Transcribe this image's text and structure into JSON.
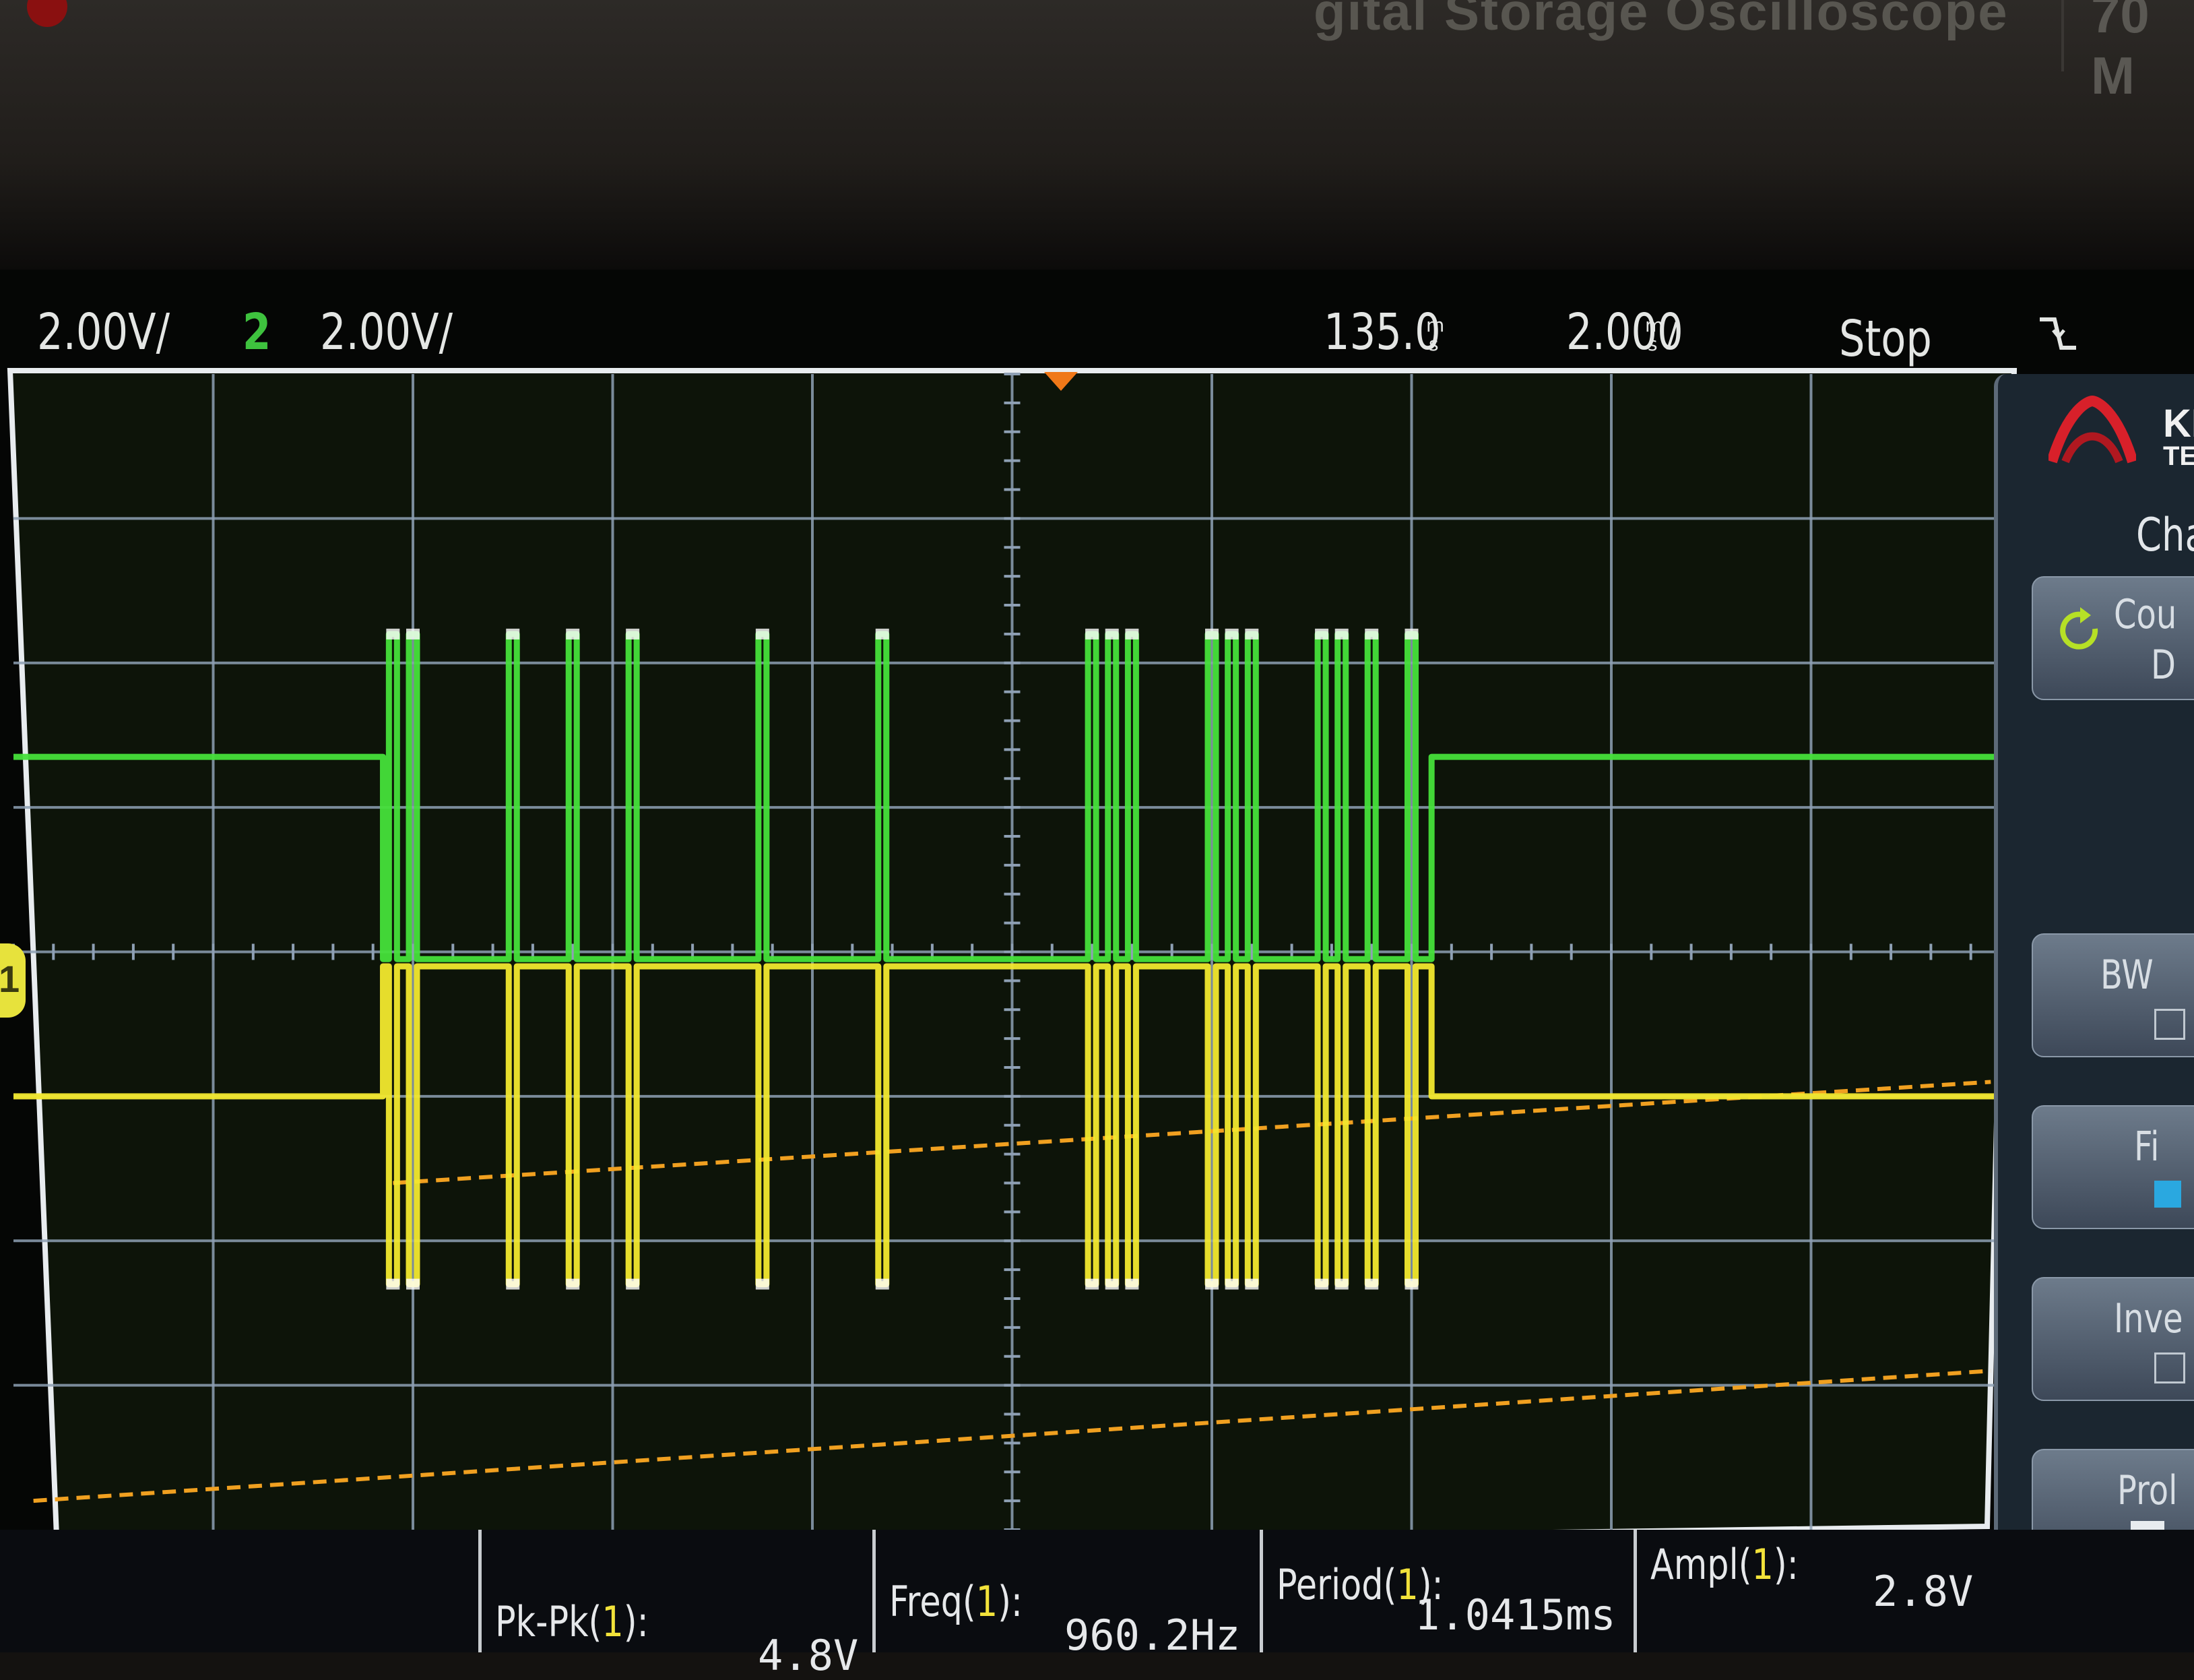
{
  "bezel": {
    "title": "gital Storage Oscilloscope",
    "bandwidth_fragment": "70 M"
  },
  "status_bar": {
    "ch1_scale": "2.00V/",
    "ch2_number": "2",
    "ch2_scale": "2.00V/",
    "horizontal_position": "135.0",
    "horizontal_position_unit_icon": "ms-unit-glyph",
    "timebase": "2.000",
    "timebase_unit_icon": "ms-per-div-glyph",
    "run_state": "Stop",
    "trigger_icon": "falling-edge-trigger-icon"
  },
  "colors": {
    "ch1": "#f2e82e",
    "ch2": "#46e03a",
    "threshold": "#f0a020",
    "grid": "#8ea0b4",
    "trigger_marker": "#f07818"
  },
  "side_menu": {
    "logo_text": "KE",
    "logo_sub": "TE",
    "title": "Cha",
    "items": [
      {
        "label": "Cou",
        "sub": "D",
        "icon": "rotate-knob-icon"
      },
      {
        "label": "BW",
        "sub": ""
      },
      {
        "label": "Fi",
        "sub": ""
      },
      {
        "label": "Inve",
        "sub": ""
      },
      {
        "label": "Prol",
        "sub": "",
        "icon": "arrow-down-icon"
      }
    ]
  },
  "measurements": [
    {
      "name": "Pk-Pk",
      "channel": "1",
      "value": "4.8V"
    },
    {
      "name": "Freq",
      "channel": "1",
      "value": "960.2Hz"
    },
    {
      "name": "Period",
      "channel": "1",
      "value": "1.0415ms"
    },
    {
      "name": "Ampl",
      "channel": "1",
      "value": "2.8V"
    }
  ],
  "channel_marker": {
    "label": "1"
  },
  "chart_data": {
    "type": "line",
    "series": [
      {
        "name": "2",
        "idle_level": "high",
        "pulses_ms": [
          [
            -6.2,
            -6.0
          ],
          [
            -5.0,
            -4.4
          ],
          [
            -3.8
          ],
          [
            -2.5
          ],
          [
            -1.3
          ],
          [
            0.8,
            1.0,
            1.2
          ],
          [
            2.0,
            2.2,
            2.4
          ],
          [
            3.1,
            3.3,
            3.6,
            4.0
          ]
        ],
        "burst_start_ms": -6.3,
        "burst_end_ms": 4.2
      },
      {
        "name": "1",
        "idle_level": "low",
        "pulses_ms": [
          [
            -6.2,
            -6.0
          ],
          [
            -5.0,
            -4.4
          ],
          [
            -3.8
          ],
          [
            -2.5
          ],
          [
            -1.3
          ],
          [
            0.8,
            1.0,
            1.2
          ],
          [
            2.0,
            2.2,
            2.4
          ],
          [
            3.1,
            3.3,
            3.6,
            4.0
          ]
        ],
        "burst_start_ms": -6.3,
        "burst_end_ms": 4.2
      }
    ],
    "xlim_div": [
      -5,
      5
    ],
    "ylim_div": [
      -4,
      4
    ],
    "grid": true
  }
}
